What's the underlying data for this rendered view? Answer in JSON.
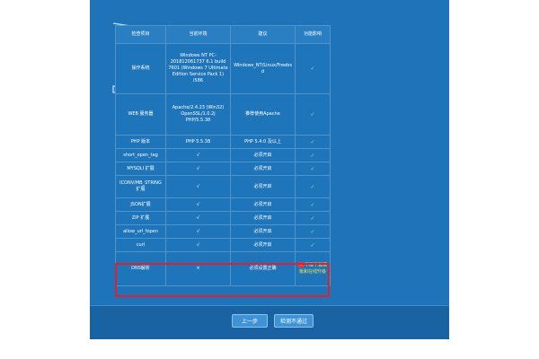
{
  "table": {
    "headers": {
      "item": "检查项目",
      "current": "当前环境",
      "suggest": "建议",
      "impact": "功能影响"
    },
    "rows": [
      {
        "item": "操作系统",
        "current": "Windows NT PC-201812061737 6.1 build 7601 (Windows 7 Ultimate Edition Service Pack 1) i586",
        "suggest": "Windows_NT/Linux/Freebsd",
        "impact": "✓"
      },
      {
        "item": "WEB 服务器",
        "current": "Apache/2.4.23 (Win32) OpenSSL/1.0.2j PHP/5.5.38",
        "suggest": "推荐使用Apache",
        "impact": "✓"
      },
      {
        "item": "PHP 版本",
        "current": "PHP 5.5.38",
        "suggest": "PHP 5.4.0 及以上",
        "impact": "✓"
      },
      {
        "item": "short_open_tag",
        "current": "√",
        "suggest": "必须开启",
        "impact": "✓"
      },
      {
        "item": "MYSQLI 扩展",
        "current": "√",
        "suggest": "必须开启",
        "impact": "✓"
      },
      {
        "item": "ICONV/MB_STRING 扩展",
        "current": "√",
        "suggest": "必须开启",
        "impact": "✓"
      },
      {
        "item": "JSON扩展",
        "current": "√",
        "suggest": "必须开启",
        "impact": "✓"
      },
      {
        "item": "ZIP 扩展",
        "current": "√",
        "suggest": "必须开启",
        "impact": "✓"
      },
      {
        "item": "allow_url_fopen",
        "current": "√",
        "suggest": "必须开启",
        "impact": "✓"
      },
      {
        "item": "curl",
        "current": "√",
        "suggest": "必须开启",
        "impact": "✓"
      },
      {
        "item": "DNS解析",
        "current": "×",
        "suggest": "必须设置正确",
        "impact": "不能下载模板和在线升级"
      }
    ]
  },
  "icons": {
    "ok": "check-icon",
    "fail": "error-x-icon"
  },
  "buttons": {
    "prev": "上一步",
    "retry": "检测不通过"
  },
  "colors": {
    "background": "#1f73b8",
    "ok": "#7ef07e",
    "warn": "#f6e05e",
    "highlight": "#e0202a"
  }
}
